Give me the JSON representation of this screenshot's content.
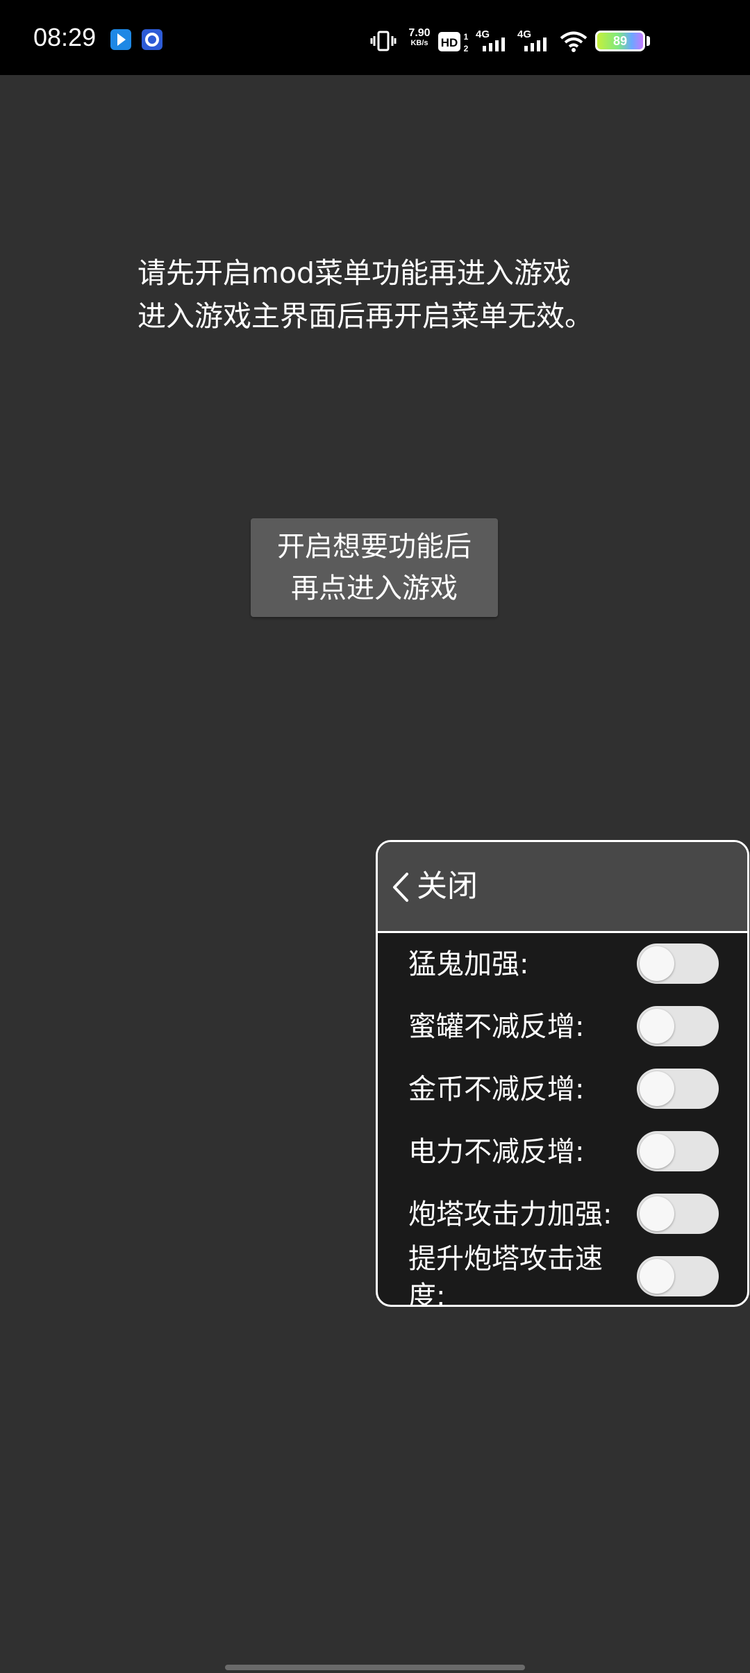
{
  "status_bar": {
    "time": "08:29",
    "net_speed_value": "7.90",
    "net_speed_unit": "KB/s",
    "battery": "89",
    "icons": [
      "vibrate-icon",
      "hd-icon",
      "signal-4g-icon",
      "signal-4g-icon",
      "wifi-icon",
      "battery-icon"
    ]
  },
  "main": {
    "notice_line1": "请先开启mod菜单功能再进入游戏",
    "notice_line2": "进入游戏主界面后再开启菜单无效。",
    "enter_button": "开启想要功能后\n再点进入游戏"
  },
  "mod_menu": {
    "title": "关闭",
    "toggles": [
      {
        "label": "猛鬼加强:",
        "on": false
      },
      {
        "label": "蜜罐不减反增:",
        "on": false
      },
      {
        "label": "金币不减反增:",
        "on": false
      },
      {
        "label": "电力不减反增:",
        "on": false
      },
      {
        "label": "炮塔攻击力加强:",
        "on": false
      },
      {
        "label": "提升炮塔攻击速度:",
        "on": false
      }
    ]
  },
  "colors": {
    "background": "#303030",
    "panel_bg": "#1a1a1a",
    "panel_header": "#484848",
    "button_bg": "#5b5b5b",
    "switch_track": "#e4e4e4"
  }
}
